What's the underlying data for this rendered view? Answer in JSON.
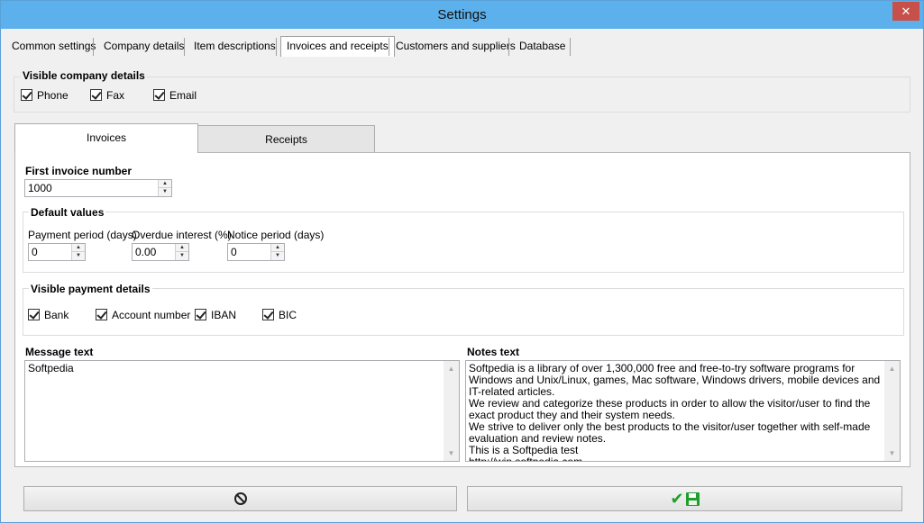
{
  "window": {
    "title": "Settings",
    "close_symbol": "✕"
  },
  "tabs": [
    {
      "label": "Common settings"
    },
    {
      "label": "Company details"
    },
    {
      "label": "Item descriptions"
    },
    {
      "label": "Invoices and receipts",
      "active": true
    },
    {
      "label": "Customers and suppliers"
    },
    {
      "label": "Database"
    }
  ],
  "visible_company_details": {
    "title": "Visible company details",
    "items": [
      {
        "label": "Phone",
        "checked": true
      },
      {
        "label": "Fax",
        "checked": true
      },
      {
        "label": "Email",
        "checked": true
      }
    ]
  },
  "subtabs": [
    {
      "label": "Invoices",
      "active": true
    },
    {
      "label": "Receipts"
    }
  ],
  "invoices": {
    "first_invoice_label": "First invoice number",
    "first_invoice_value": "1000",
    "default_values": {
      "title": "Default values",
      "payment_period_label": "Payment period  (days)",
      "payment_period_value": "0",
      "overdue_interest_label": "Overdue interest  (%)",
      "overdue_interest_value": "0.00",
      "notice_period_label": "Notice period  (days)",
      "notice_period_value": "0"
    },
    "visible_payment_details": {
      "title": "Visible payment details",
      "items": [
        {
          "label": "Bank",
          "checked": true
        },
        {
          "label": "Account number",
          "checked": true
        },
        {
          "label": "IBAN",
          "checked": true
        },
        {
          "label": "BIC",
          "checked": true
        }
      ]
    },
    "message_text_label": "Message text",
    "message_text_value": "Softpedia",
    "notes_text_label": "Notes text",
    "notes_text_value": "Softpedia is a library of over 1,300,000 free and free-to-try software programs for Windows and Unix/Linux, games, Mac software, Windows drivers, mobile devices and IT-related articles.\nWe review and categorize these products in order to allow the visitor/user to find the exact product they and their system needs.\nWe strive to deliver only the best products to the visitor/user together with self-made evaluation and review notes.\nThis is a Softpedia test\nhttp://win.softpedia.com"
  },
  "icons": {
    "cancel": "cancel-icon",
    "save": "check-save-icon",
    "accent_green": "#1f9e2a"
  }
}
